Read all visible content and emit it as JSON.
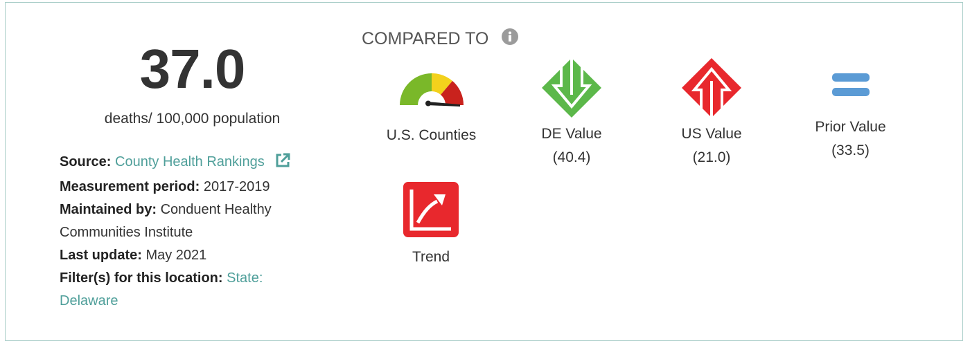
{
  "value": "37.0",
  "unit": "deaths/ 100,000 population",
  "meta": {
    "source_label": "Source:",
    "source_link": "County Health Rankings",
    "period_label": "Measurement period:",
    "period_value": "2017-2019",
    "maintained_label": "Maintained by:",
    "maintained_value": "Conduent Healthy Communities Institute",
    "updated_label": "Last update:",
    "updated_value": "May 2021",
    "filter_label": "Filter(s) for this location:",
    "filter_value": "State: Delaware"
  },
  "compared_to": {
    "heading": "COMPARED TO",
    "items": [
      {
        "label": "U.S. Counties",
        "icon": "gauge-icon"
      },
      {
        "label": "DE Value",
        "sub": "(40.4)",
        "icon": "arrow-down-icon"
      },
      {
        "label": "US Value",
        "sub": "(21.0)",
        "icon": "arrow-up-icon"
      },
      {
        "label": "Prior Value",
        "sub": "(33.5)",
        "icon": "equal-icon"
      },
      {
        "label": "Trend",
        "icon": "trend-up-icon"
      }
    ]
  },
  "colors": {
    "link": "#4f9f9a",
    "green": "#5cb84a",
    "red": "#e8282d",
    "blue": "#5b9bd5",
    "border": "#a9cdc8"
  }
}
